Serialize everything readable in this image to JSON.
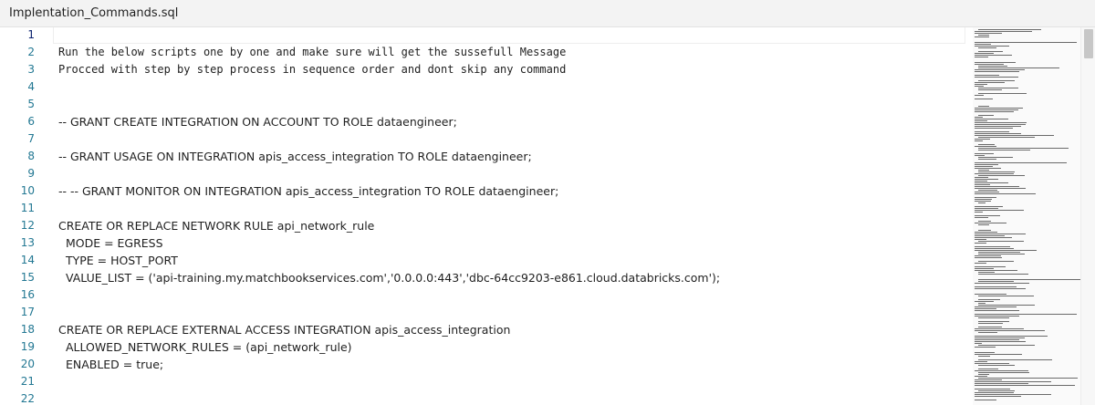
{
  "tab": {
    "title": "Implentation_Commands.sql"
  },
  "lines": [
    {
      "n": "1",
      "text": "",
      "mono": false
    },
    {
      "n": "2",
      "text": "Run the below scripts one by one and make sure will get the sussefull Message",
      "mono": true
    },
    {
      "n": "3",
      "text": "Procced with step by step process in sequence order and dont skip any command",
      "mono": true
    },
    {
      "n": "4",
      "text": "",
      "mono": false
    },
    {
      "n": "5",
      "text": "",
      "mono": false
    },
    {
      "n": "6",
      "text": "-- GRANT CREATE INTEGRATION ON ACCOUNT TO ROLE dataengineer;",
      "mono": false
    },
    {
      "n": "7",
      "text": "",
      "mono": false
    },
    {
      "n": "8",
      "text": "-- GRANT USAGE ON INTEGRATION apis_access_integration TO ROLE dataengineer;",
      "mono": false
    },
    {
      "n": "9",
      "text": "",
      "mono": false
    },
    {
      "n": "10",
      "text": "-- -- GRANT MONITOR ON INTEGRATION apis_access_integration TO ROLE dataengineer;",
      "mono": false
    },
    {
      "n": "11",
      "text": "",
      "mono": false
    },
    {
      "n": "12",
      "text": "CREATE OR REPLACE NETWORK RULE api_network_rule",
      "mono": false
    },
    {
      "n": "13",
      "text": "  MODE = EGRESS",
      "mono": false
    },
    {
      "n": "14",
      "text": "  TYPE = HOST_PORT",
      "mono": false
    },
    {
      "n": "15",
      "text": "  VALUE_LIST = ('api-training.my.matchbookservices.com','0.0.0.0:443','dbc-64cc9203-e861.cloud.databricks.com');",
      "mono": false
    },
    {
      "n": "16",
      "text": "",
      "mono": false
    },
    {
      "n": "17",
      "text": "",
      "mono": false
    },
    {
      "n": "18",
      "text": "CREATE OR REPLACE EXTERNAL ACCESS INTEGRATION apis_access_integration",
      "mono": false
    },
    {
      "n": "19",
      "text": "  ALLOWED_NETWORK_RULES = (api_network_rule)",
      "mono": false
    },
    {
      "n": "20",
      "text": "  ENABLED = true;",
      "mono": false
    },
    {
      "n": "21",
      "text": "",
      "mono": false
    },
    {
      "n": "22",
      "text": "",
      "mono": false
    }
  ]
}
